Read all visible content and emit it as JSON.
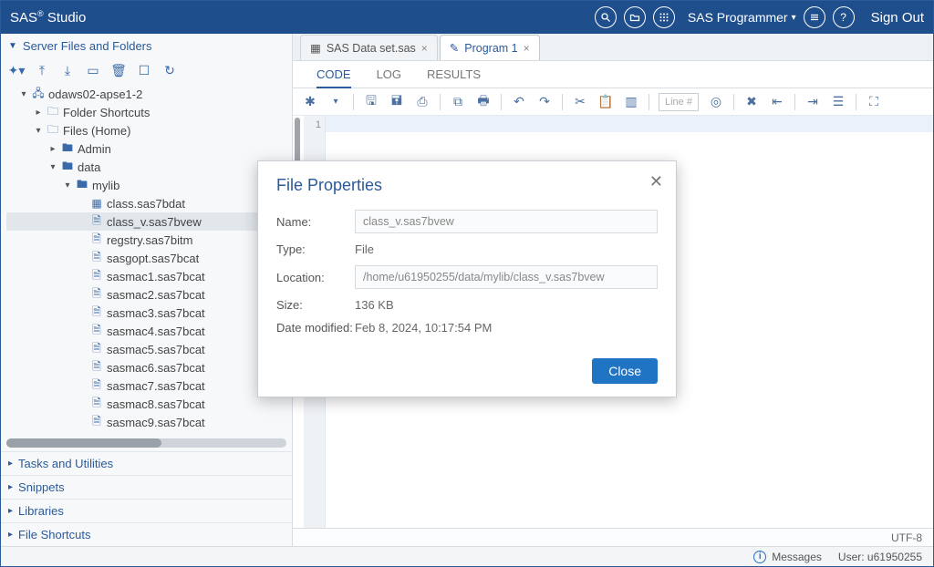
{
  "topbar": {
    "brand_html": "SAS® Studio",
    "role": "SAS Programmer",
    "signout": "Sign Out"
  },
  "sidebar": {
    "header": "Server Files and Folders",
    "sections": {
      "tasks": "Tasks and Utilities",
      "snippets": "Snippets",
      "libraries": "Libraries",
      "shortcuts": "File Shortcuts"
    },
    "tree": {
      "root": "odaws02-apse1-2",
      "folder_shortcuts": "Folder Shortcuts",
      "files_home": "Files (Home)",
      "admin": "Admin",
      "data": "data",
      "mylib": "mylib",
      "files": [
        "class.sas7bdat",
        "class_v.sas7bvew",
        "regstry.sas7bitm",
        "sasgopt.sas7bcat",
        "sasmac1.sas7bcat",
        "sasmac2.sas7bcat",
        "sasmac3.sas7bcat",
        "sasmac4.sas7bcat",
        "sasmac5.sas7bcat",
        "sasmac6.sas7bcat",
        "sasmac7.sas7bcat",
        "sasmac8.sas7bcat",
        "sasmac9.sas7bcat"
      ],
      "selected_index": 1
    }
  },
  "editor": {
    "tabs": [
      {
        "icon": "table",
        "label": "SAS Data set.sas",
        "active": false
      },
      {
        "icon": "code",
        "label": "Program 1",
        "active": true
      }
    ],
    "subtabs": {
      "code": "CODE",
      "log": "LOG",
      "results": "RESULTS"
    },
    "linebox": "Line #",
    "gutter_first": "1",
    "encoding": "UTF-8"
  },
  "footer": {
    "messages": "Messages",
    "user_label": "User:",
    "user_value": "u61950255"
  },
  "modal": {
    "title": "File Properties",
    "labels": {
      "name": "Name:",
      "type": "Type:",
      "location": "Location:",
      "size": "Size:",
      "modified": "Date modified:"
    },
    "values": {
      "name": "class_v.sas7bvew",
      "type": "File",
      "location": "/home/u61950255/data/mylib/class_v.sas7bvew",
      "size": "136 KB",
      "modified": "Feb 8, 2024, 10:17:54 PM"
    },
    "close": "Close"
  }
}
